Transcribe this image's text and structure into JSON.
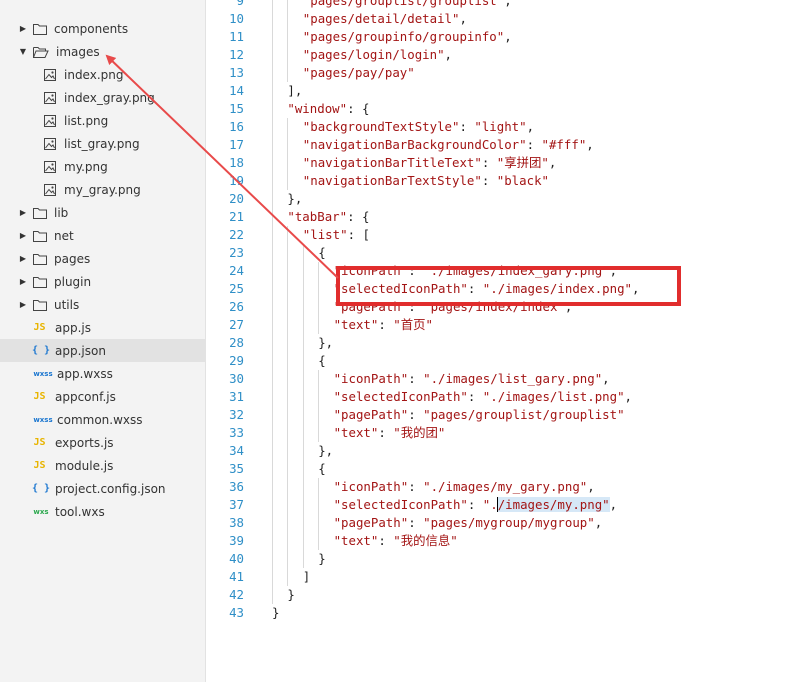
{
  "file_tree": {
    "items": [
      {
        "type": "folder",
        "label": "components",
        "expanded": false,
        "level": 0
      },
      {
        "type": "folder",
        "label": "images",
        "expanded": true,
        "level": 0
      },
      {
        "type": "image",
        "label": "index.png",
        "level": 1
      },
      {
        "type": "image",
        "label": "index_gray.png",
        "level": 1
      },
      {
        "type": "image",
        "label": "list.png",
        "level": 1
      },
      {
        "type": "image",
        "label": "list_gray.png",
        "level": 1
      },
      {
        "type": "image",
        "label": "my.png",
        "level": 1
      },
      {
        "type": "image",
        "label": "my_gray.png",
        "level": 1
      },
      {
        "type": "folder",
        "label": "lib",
        "expanded": false,
        "level": 0
      },
      {
        "type": "folder",
        "label": "net",
        "expanded": false,
        "level": 0
      },
      {
        "type": "folder",
        "label": "pages",
        "expanded": false,
        "level": 0
      },
      {
        "type": "folder",
        "label": "plugin",
        "expanded": false,
        "level": 0
      },
      {
        "type": "folder",
        "label": "utils",
        "expanded": false,
        "level": 0
      },
      {
        "type": "js",
        "label": "app.js",
        "icon_text": "JS",
        "level": 0
      },
      {
        "type": "json",
        "label": "app.json",
        "icon_text": "{ }",
        "level": 0,
        "selected": true
      },
      {
        "type": "wxss",
        "label": "app.wxss",
        "icon_text": "wxss",
        "level": 0
      },
      {
        "type": "js",
        "label": "appconf.js",
        "icon_text": "JS",
        "level": 0
      },
      {
        "type": "wxss",
        "label": "common.wxss",
        "icon_text": "wxss",
        "level": 0
      },
      {
        "type": "js",
        "label": "exports.js",
        "icon_text": "JS",
        "level": 0
      },
      {
        "type": "js",
        "label": "module.js",
        "icon_text": "JS",
        "level": 0
      },
      {
        "type": "json",
        "label": "project.config.json",
        "icon_text": "{ }",
        "level": 0
      },
      {
        "type": "wxs",
        "label": "tool.wxs",
        "icon_text": "wxs",
        "level": 0
      }
    ]
  },
  "editor": {
    "lines": [
      {
        "n": "9",
        "indent": 2,
        "tokens": [
          {
            "t": "\"pages/grouplist/grouplist\"",
            "c": "s"
          },
          {
            "t": ",",
            "c": "p"
          }
        ]
      },
      {
        "n": "10",
        "indent": 2,
        "tokens": [
          {
            "t": "\"pages/detail/detail\"",
            "c": "s"
          },
          {
            "t": ",",
            "c": "p"
          }
        ]
      },
      {
        "n": "11",
        "indent": 2,
        "tokens": [
          {
            "t": "\"pages/groupinfo/groupinfo\"",
            "c": "s"
          },
          {
            "t": ",",
            "c": "p"
          }
        ]
      },
      {
        "n": "12",
        "indent": 2,
        "tokens": [
          {
            "t": "\"pages/login/login\"",
            "c": "s"
          },
          {
            "t": ",",
            "c": "p"
          }
        ]
      },
      {
        "n": "13",
        "indent": 2,
        "tokens": [
          {
            "t": "\"pages/pay/pay\"",
            "c": "s"
          }
        ]
      },
      {
        "n": "14",
        "indent": 1,
        "tokens": [
          {
            "t": "],",
            "c": "p"
          }
        ]
      },
      {
        "n": "15",
        "indent": 1,
        "tokens": [
          {
            "t": "\"window\"",
            "c": "s"
          },
          {
            "t": ": {",
            "c": "p"
          }
        ]
      },
      {
        "n": "16",
        "indent": 2,
        "tokens": [
          {
            "t": "\"backgroundTextStyle\"",
            "c": "s"
          },
          {
            "t": ": ",
            "c": "p"
          },
          {
            "t": "\"light\"",
            "c": "s"
          },
          {
            "t": ",",
            "c": "p"
          }
        ]
      },
      {
        "n": "17",
        "indent": 2,
        "tokens": [
          {
            "t": "\"navigationBarBackgroundColor\"",
            "c": "s"
          },
          {
            "t": ": ",
            "c": "p"
          },
          {
            "t": "\"#fff\"",
            "c": "s"
          },
          {
            "t": ",",
            "c": "p"
          }
        ]
      },
      {
        "n": "18",
        "indent": 2,
        "tokens": [
          {
            "t": "\"navigationBarTitleText\"",
            "c": "s"
          },
          {
            "t": ": ",
            "c": "p"
          },
          {
            "t": "\"享拼团\"",
            "c": "s"
          },
          {
            "t": ",",
            "c": "p"
          }
        ]
      },
      {
        "n": "19",
        "indent": 2,
        "tokens": [
          {
            "t": "\"navigationBarTextStyle\"",
            "c": "s"
          },
          {
            "t": ": ",
            "c": "p"
          },
          {
            "t": "\"black\"",
            "c": "s"
          }
        ]
      },
      {
        "n": "20",
        "indent": 1,
        "tokens": [
          {
            "t": "},",
            "c": "p"
          }
        ]
      },
      {
        "n": "21",
        "indent": 1,
        "tokens": [
          {
            "t": "\"tabBar\"",
            "c": "s"
          },
          {
            "t": ": {",
            "c": "p"
          }
        ]
      },
      {
        "n": "22",
        "indent": 2,
        "tokens": [
          {
            "t": "\"list\"",
            "c": "s"
          },
          {
            "t": ": [",
            "c": "p"
          }
        ]
      },
      {
        "n": "23",
        "indent": 3,
        "tokens": [
          {
            "t": "{",
            "c": "p"
          }
        ]
      },
      {
        "n": "24",
        "indent": 4,
        "tokens": [
          {
            "t": "\"iconPath\"",
            "c": "s"
          },
          {
            "t": ": ",
            "c": "p"
          },
          {
            "t": "\"./images/index_gary.png\"",
            "c": "s"
          },
          {
            "t": ",",
            "c": "p"
          }
        ]
      },
      {
        "n": "25",
        "indent": 4,
        "tokens": [
          {
            "t": "\"selectedIconPath\"",
            "c": "s"
          },
          {
            "t": ": ",
            "c": "p"
          },
          {
            "t": "\"./images/index.png\"",
            "c": "s"
          },
          {
            "t": ",",
            "c": "p"
          }
        ]
      },
      {
        "n": "26",
        "indent": 4,
        "tokens": [
          {
            "t": "\"pagePath\"",
            "c": "s"
          },
          {
            "t": ": ",
            "c": "p"
          },
          {
            "t": "\"pages/index/index\"",
            "c": "s"
          },
          {
            "t": ",",
            "c": "p"
          }
        ]
      },
      {
        "n": "27",
        "indent": 4,
        "tokens": [
          {
            "t": "\"text\"",
            "c": "s"
          },
          {
            "t": ": ",
            "c": "p"
          },
          {
            "t": "\"首页\"",
            "c": "s"
          }
        ]
      },
      {
        "n": "28",
        "indent": 3,
        "tokens": [
          {
            "t": "},",
            "c": "p"
          }
        ]
      },
      {
        "n": "29",
        "indent": 3,
        "tokens": [
          {
            "t": "{",
            "c": "p"
          }
        ]
      },
      {
        "n": "30",
        "indent": 4,
        "tokens": [
          {
            "t": "\"iconPath\"",
            "c": "s"
          },
          {
            "t": ": ",
            "c": "p"
          },
          {
            "t": "\"./images/list_gary.png\"",
            "c": "s"
          },
          {
            "t": ",",
            "c": "p"
          }
        ]
      },
      {
        "n": "31",
        "indent": 4,
        "tokens": [
          {
            "t": "\"selectedIconPath\"",
            "c": "s"
          },
          {
            "t": ": ",
            "c": "p"
          },
          {
            "t": "\"./images/list.png\"",
            "c": "s"
          },
          {
            "t": ",",
            "c": "p"
          }
        ]
      },
      {
        "n": "32",
        "indent": 4,
        "tokens": [
          {
            "t": "\"pagePath\"",
            "c": "s"
          },
          {
            "t": ": ",
            "c": "p"
          },
          {
            "t": "\"pages/grouplist/grouplist\"",
            "c": "s"
          }
        ]
      },
      {
        "n": "33",
        "indent": 4,
        "tokens": [
          {
            "t": "\"text\"",
            "c": "s"
          },
          {
            "t": ": ",
            "c": "p"
          },
          {
            "t": "\"我的团\"",
            "c": "s"
          }
        ]
      },
      {
        "n": "34",
        "indent": 3,
        "tokens": [
          {
            "t": "},",
            "c": "p"
          }
        ]
      },
      {
        "n": "35",
        "indent": 3,
        "tokens": [
          {
            "t": "{",
            "c": "p"
          }
        ]
      },
      {
        "n": "36",
        "indent": 4,
        "tokens": [
          {
            "t": "\"iconPath\"",
            "c": "s"
          },
          {
            "t": ": ",
            "c": "p"
          },
          {
            "t": "\"./images/my_gary.png\"",
            "c": "s"
          },
          {
            "t": ",",
            "c": "p"
          }
        ]
      },
      {
        "n": "37",
        "indent": 4,
        "tokens": [
          {
            "t": "\"selectedIconPath\"",
            "c": "s"
          },
          {
            "t": ": ",
            "c": "p"
          },
          {
            "t": "\".",
            "c": "s"
          },
          {
            "t": "/images/my.png\"",
            "c": "s",
            "hl": true
          },
          {
            "t": ",",
            "c": "p"
          }
        ]
      },
      {
        "n": "38",
        "indent": 4,
        "tokens": [
          {
            "t": "\"pagePath\"",
            "c": "s"
          },
          {
            "t": ": ",
            "c": "p"
          },
          {
            "t": "\"pages/mygroup/mygroup\"",
            "c": "s"
          },
          {
            "t": ",",
            "c": "p"
          }
        ]
      },
      {
        "n": "39",
        "indent": 4,
        "tokens": [
          {
            "t": "\"text\"",
            "c": "s"
          },
          {
            "t": ": ",
            "c": "p"
          },
          {
            "t": "\"我的信息\"",
            "c": "s"
          }
        ]
      },
      {
        "n": "40",
        "indent": 3,
        "tokens": [
          {
            "t": "}",
            "c": "p"
          }
        ]
      },
      {
        "n": "41",
        "indent": 2,
        "tokens": [
          {
            "t": "]",
            "c": "p"
          }
        ]
      },
      {
        "n": "42",
        "indent": 1,
        "tokens": [
          {
            "t": "}",
            "c": "p"
          }
        ]
      },
      {
        "n": "43",
        "indent": 0,
        "tokens": [
          {
            "t": "}",
            "c": "p"
          }
        ]
      }
    ]
  },
  "annotation": {
    "box_color": "#e12d2d",
    "arrow_color": "#e84a4a",
    "arrow_from_line": "24",
    "arrow_to_item": "images"
  }
}
